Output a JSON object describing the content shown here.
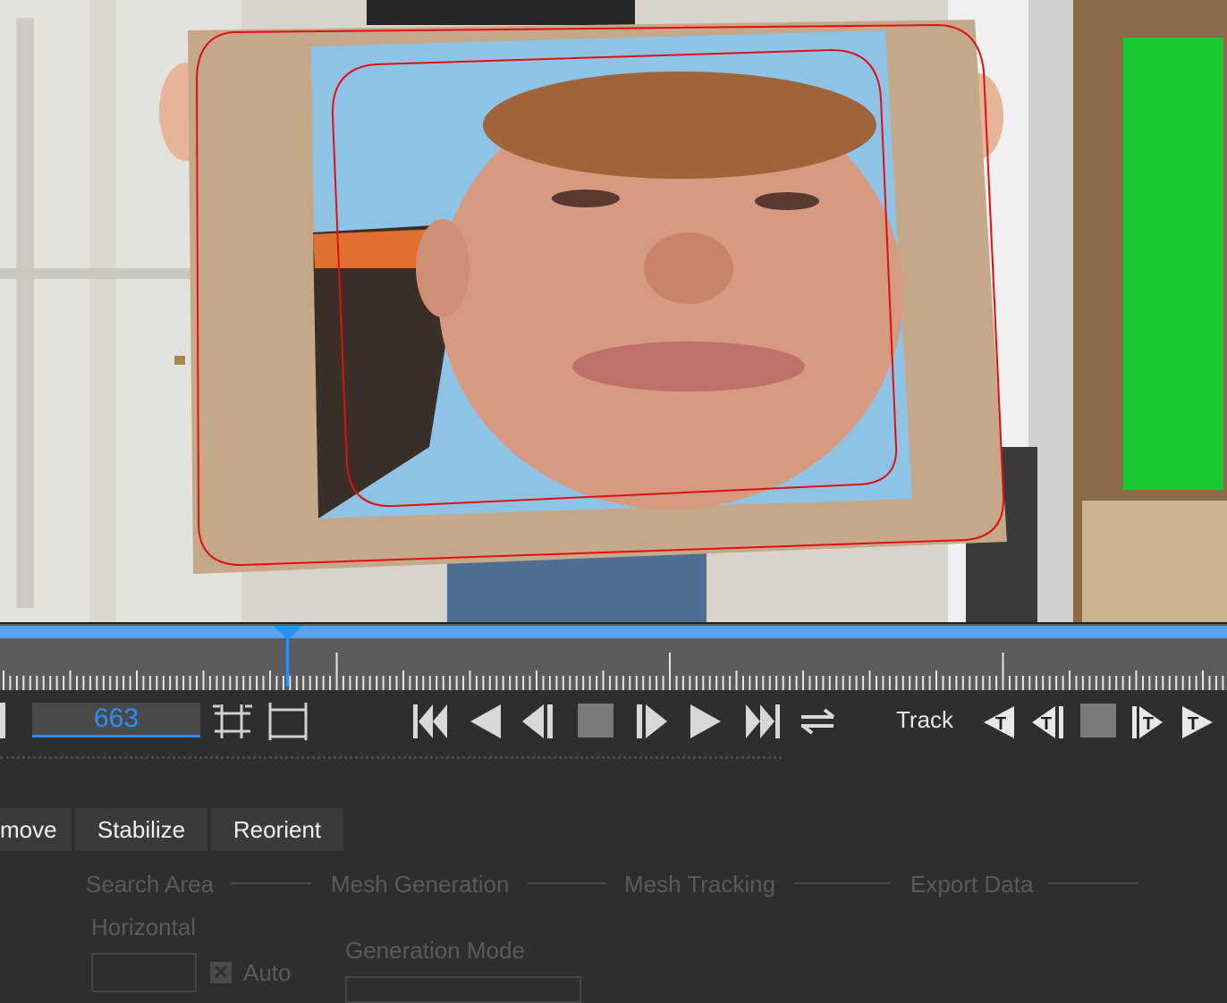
{
  "viewer": {
    "image_description_icon": "video-frame"
  },
  "transport": {
    "frame_number": "663",
    "track_label": "Track",
    "icons": {
      "set_in": "set-in-point-icon",
      "set_out": "set-out-point-icon",
      "go_start": "go-to-start-icon",
      "play_backward": "play-backward-icon",
      "step_back": "step-back-icon",
      "stop": "stop-icon",
      "step_forward": "step-forward-icon",
      "play_forward": "play-forward-icon",
      "go_end": "go-to-end-icon",
      "loop": "loop-icon",
      "track_backward": "track-backward-icon",
      "track_step_back": "track-step-back-icon",
      "track_stop": "track-stop-icon",
      "track_step_forward": "track-step-forward-icon",
      "track_forward": "track-forward-icon"
    }
  },
  "tabs": [
    {
      "label": "move"
    },
    {
      "label": "Stabilize"
    },
    {
      "label": "Reorient"
    }
  ],
  "panel": {
    "sections": [
      "Search Area",
      "Mesh Generation",
      "Mesh Tracking",
      "Export Data"
    ],
    "horizontal_label": "Horizontal",
    "auto_label": "Auto",
    "generation_mode_label": "Generation Mode"
  },
  "colors": {
    "accent": "#2c8dff",
    "timeline_bar": "#5aa0f0",
    "tracking_spline": "#e01010"
  }
}
